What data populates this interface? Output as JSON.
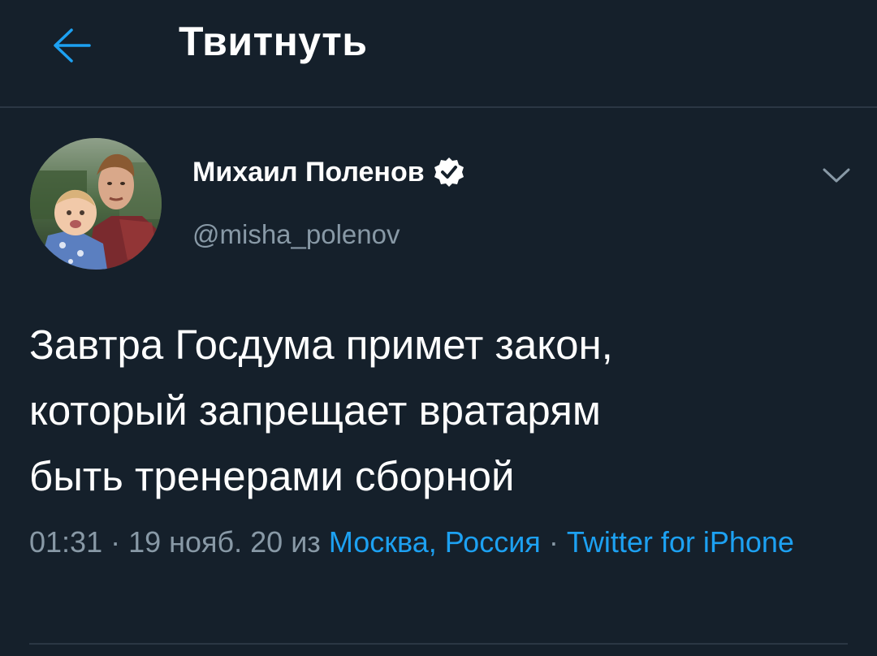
{
  "header": {
    "title": "Твитнуть",
    "back_icon": "arrow-left-icon",
    "back_icon_color": "#1da1f2"
  },
  "tweet": {
    "author": {
      "display_name": "Михаил Поленов",
      "handle": "@misha_polenov",
      "verified": true
    },
    "menu_icon": "chevron-down-icon",
    "text": "Завтра Госдума примет закон,\nкоторый запрещает вратарям\nбыть тренерами сборной",
    "meta": {
      "time_date": "01:31 · 19 нояб. 20 из",
      "location": "Москва, Россия",
      "separator": "·",
      "source": "Twitter for iPhone"
    }
  },
  "colors": {
    "background": "#15202b",
    "accent": "#1da1f2",
    "secondary_text": "#8899a6",
    "divider": "#2b3744"
  }
}
